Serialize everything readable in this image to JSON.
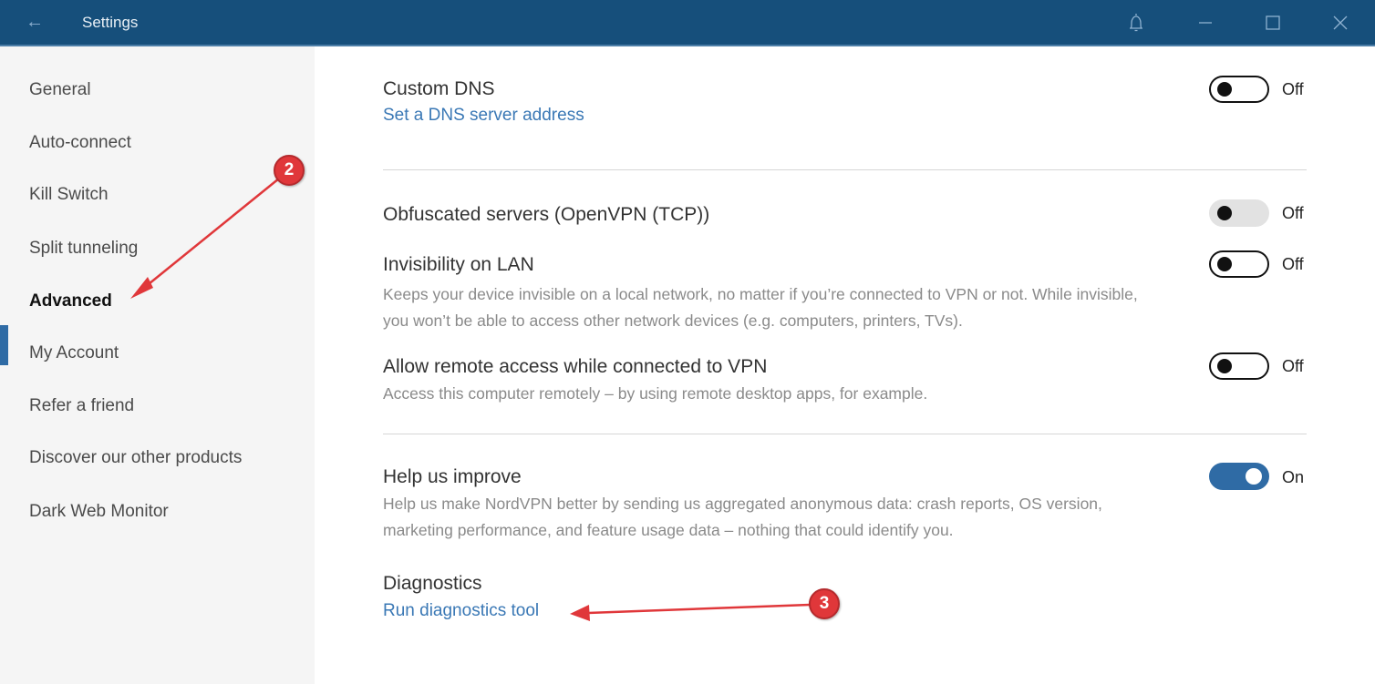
{
  "titlebar": {
    "title": "Settings",
    "back_icon": "arrow-left-icon",
    "controls": [
      "bell-icon",
      "minimize-icon",
      "maximize-icon",
      "close-icon"
    ]
  },
  "sidebar": {
    "items": [
      {
        "label": "General",
        "active": false
      },
      {
        "label": "Auto-connect",
        "active": false
      },
      {
        "label": "Kill Switch",
        "active": false
      },
      {
        "label": "Split tunneling",
        "active": false
      },
      {
        "label": "Advanced",
        "active": true
      },
      {
        "label": "My Account",
        "active": false
      },
      {
        "label": "Refer a friend",
        "active": false
      },
      {
        "label": "Discover our other products",
        "active": false
      },
      {
        "label": "Dark Web Monitor",
        "active": false
      }
    ]
  },
  "settings": {
    "custom_dns": {
      "label": "Custom DNS",
      "link": "Set a DNS server address",
      "state": "Off"
    },
    "obfuscated": {
      "label": "Obfuscated servers (OpenVPN (TCP))",
      "state": "Off",
      "disabled": true
    },
    "invisibility": {
      "label": "Invisibility on LAN",
      "desc_line1": "Keeps your device invisible on a local network, no matter if you’re connected to VPN or not. While invisible,",
      "desc_line2": "you won’t be able to access other network devices (e.g. computers, printers, TVs).",
      "state": "Off"
    },
    "remote_access": {
      "label": "Allow remote access while connected to VPN",
      "desc": "Access this computer remotely – by using remote desktop apps, for example.",
      "state": "Off"
    },
    "help_improve": {
      "label": "Help us improve",
      "desc_line1": "Help us make NordVPN better by sending us aggregated anonymous data: crash reports, OS version,",
      "desc_line2": "marketing performance, and feature usage data – nothing that could identify you.",
      "state": "On"
    },
    "diagnostics": {
      "label": "Diagnostics",
      "link": "Run diagnostics tool"
    }
  },
  "annotations": {
    "badge_2": "2",
    "badge_3": "3"
  },
  "colors": {
    "titlebar": "#164f7b",
    "accent": "#2f6ba5",
    "link": "#3a78b5",
    "annotation": "#e0373a"
  }
}
